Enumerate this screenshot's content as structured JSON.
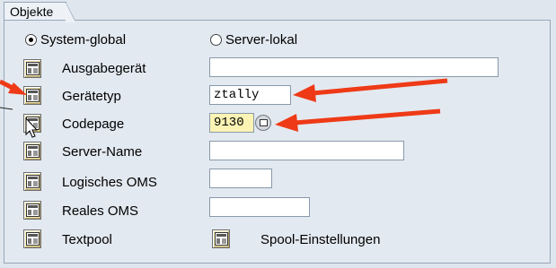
{
  "tab": {
    "label": "Objekte"
  },
  "radios": [
    {
      "label": "System-global",
      "selected": true
    },
    {
      "label": "Server-lokal",
      "selected": false
    }
  ],
  "rows": [
    {
      "label": "Ausgabegerät",
      "value": ""
    },
    {
      "label": "Gerätetyp",
      "value": "ztally"
    },
    {
      "label": "Codepage",
      "value": "9130"
    },
    {
      "label": "Server-Name",
      "value": ""
    },
    {
      "label": "Logisches OMS",
      "value": ""
    },
    {
      "label": "Reales OMS",
      "value": ""
    },
    {
      "label": "Textpool",
      "value": ""
    }
  ],
  "spool_button": {
    "label": "Spool-Einstellungen"
  },
  "colors": {
    "arrow": "#ee3a17",
    "required_field": "#fbf3b4",
    "button": "#f6e9b2"
  }
}
